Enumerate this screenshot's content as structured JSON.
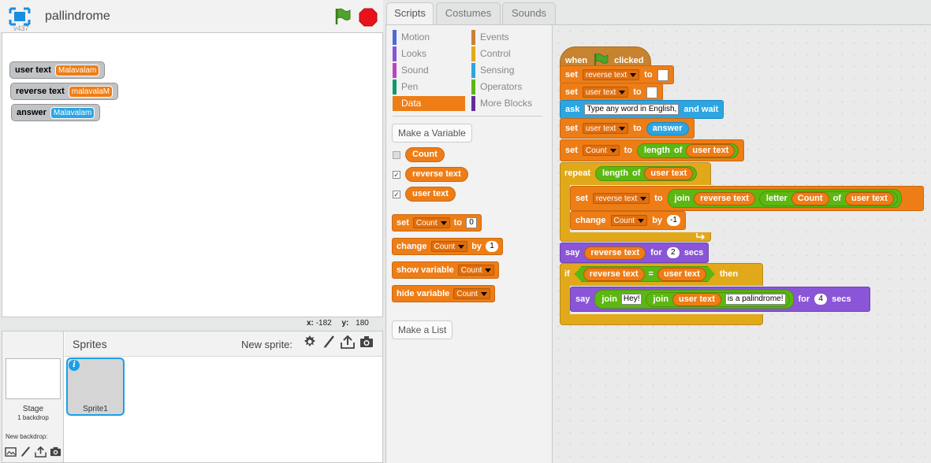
{
  "app": {
    "version": "v437",
    "project_title": "pallindrome",
    "colors": {
      "accent": "#1aa0e8",
      "control": "#e1a91a",
      "data": "#ee7d16",
      "operators": "#5cb712",
      "looks": "#8a55d7",
      "sensing": "#2ca5e2",
      "events": "#c88330"
    }
  },
  "stage": {
    "monitors": [
      {
        "label": "user text",
        "value": "Malavalam",
        "color": "orange"
      },
      {
        "label": "reverse text",
        "value": "malavalaM",
        "color": "orange"
      },
      {
        "label": "answer",
        "value": "Malavalam",
        "color": "blue"
      }
    ],
    "mouse": {
      "x_label": "x:",
      "x_value": "-182",
      "y_label": "y:",
      "y_value": "180"
    }
  },
  "sprites": {
    "title": "Sprites",
    "new_sprite_label": "New sprite:",
    "stage_label": "Stage",
    "backdrop_count": "1 backdrop",
    "new_backdrop_label": "New backdrop:",
    "items": [
      {
        "name": "Sprite1",
        "info": "i"
      }
    ]
  },
  "tabs": [
    {
      "label": "Scripts"
    },
    {
      "label": "Costumes"
    },
    {
      "label": "Sounds"
    }
  ],
  "palette": {
    "categories": [
      {
        "label": "Motion",
        "color": "#4a6cd4"
      },
      {
        "label": "Events",
        "color": "#c88330"
      },
      {
        "label": "Looks",
        "color": "#8a55d7"
      },
      {
        "label": "Control",
        "color": "#e1a91a"
      },
      {
        "label": "Sound",
        "color": "#bb42c3"
      },
      {
        "label": "Sensing",
        "color": "#2ca5e2"
      },
      {
        "label": "Pen",
        "color": "#0e9a6c"
      },
      {
        "label": "Operators",
        "color": "#5cb712"
      },
      {
        "label": "Data",
        "color": "#ee7d16"
      },
      {
        "label": "More Blocks",
        "color": "#632d99"
      }
    ],
    "make_variable": "Make a Variable",
    "variables": [
      {
        "name": "Count",
        "checked": ""
      },
      {
        "name": "reverse text",
        "checked": "✓"
      },
      {
        "name": "user text",
        "checked": "✓"
      }
    ],
    "blocks": {
      "set": {
        "kw": "set",
        "var": "Count",
        "to": "to",
        "val": "0"
      },
      "change": {
        "kw": "change",
        "var": "Count",
        "by": "by",
        "val": "1"
      },
      "show": {
        "kw": "show variable",
        "var": "Count"
      },
      "hide": {
        "kw": "hide variable",
        "var": "Count"
      }
    },
    "make_list": "Make a List"
  },
  "script": {
    "hat": {
      "when": "when",
      "clicked": "clicked"
    },
    "b1": {
      "kw": "set",
      "var": "reverse text",
      "to": "to",
      "val": ""
    },
    "b2": {
      "kw": "set",
      "var": "user text",
      "to": "to",
      "val": ""
    },
    "b3": {
      "kw": "ask",
      "text": "Type any word in English,",
      "wait": "and wait"
    },
    "b4": {
      "kw": "set",
      "var": "user text",
      "to": "to",
      "rep": "answer"
    },
    "b5": {
      "kw": "set",
      "var": "Count",
      "to": "to",
      "fn": "length",
      "of": "of",
      "rep": "user text"
    },
    "repeat": {
      "kw": "repeat",
      "fn": "length",
      "of": "of",
      "rep": "user text"
    },
    "b6": {
      "kw": "set",
      "var": "reverse text",
      "to": "to",
      "join": "join",
      "rep1": "reverse text",
      "letter": "letter",
      "rep2": "Count",
      "of": "of",
      "rep3": "user text"
    },
    "b7": {
      "kw": "change",
      "var": "Count",
      "by": "by",
      "val": "-1"
    },
    "b8": {
      "kw": "say",
      "rep": "reverse text",
      "for": "for",
      "val": "2",
      "secs": "secs"
    },
    "if": {
      "kw": "if",
      "rep1": "reverse text",
      "eq": "=",
      "rep2": "user text",
      "then": "then"
    },
    "b9": {
      "kw": "say",
      "join": "join",
      "hey": "Hey!",
      "join2": "join",
      "rep": "user text",
      "pal": "is a palindrome!",
      "for": "for",
      "val": "4",
      "secs": "secs"
    }
  }
}
